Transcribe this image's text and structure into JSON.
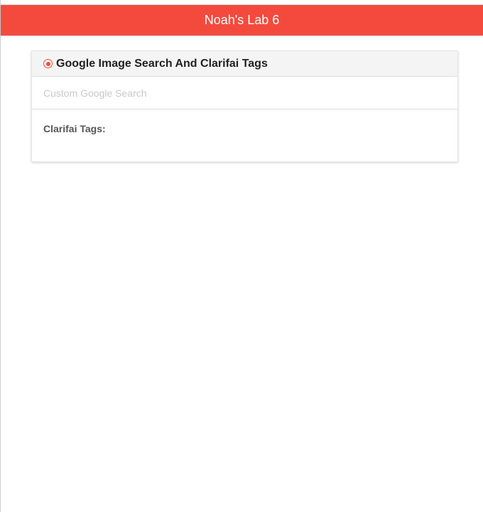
{
  "header": {
    "title": "Noah's Lab 6"
  },
  "card": {
    "icon": "radio-selected-icon",
    "title": "Google Image Search And Clarifai Tags",
    "search": {
      "placeholder": "Custom Google Search",
      "value": ""
    },
    "tags_label": "Clarifai Tags:"
  },
  "colors": {
    "accent": "#f44a3d"
  }
}
